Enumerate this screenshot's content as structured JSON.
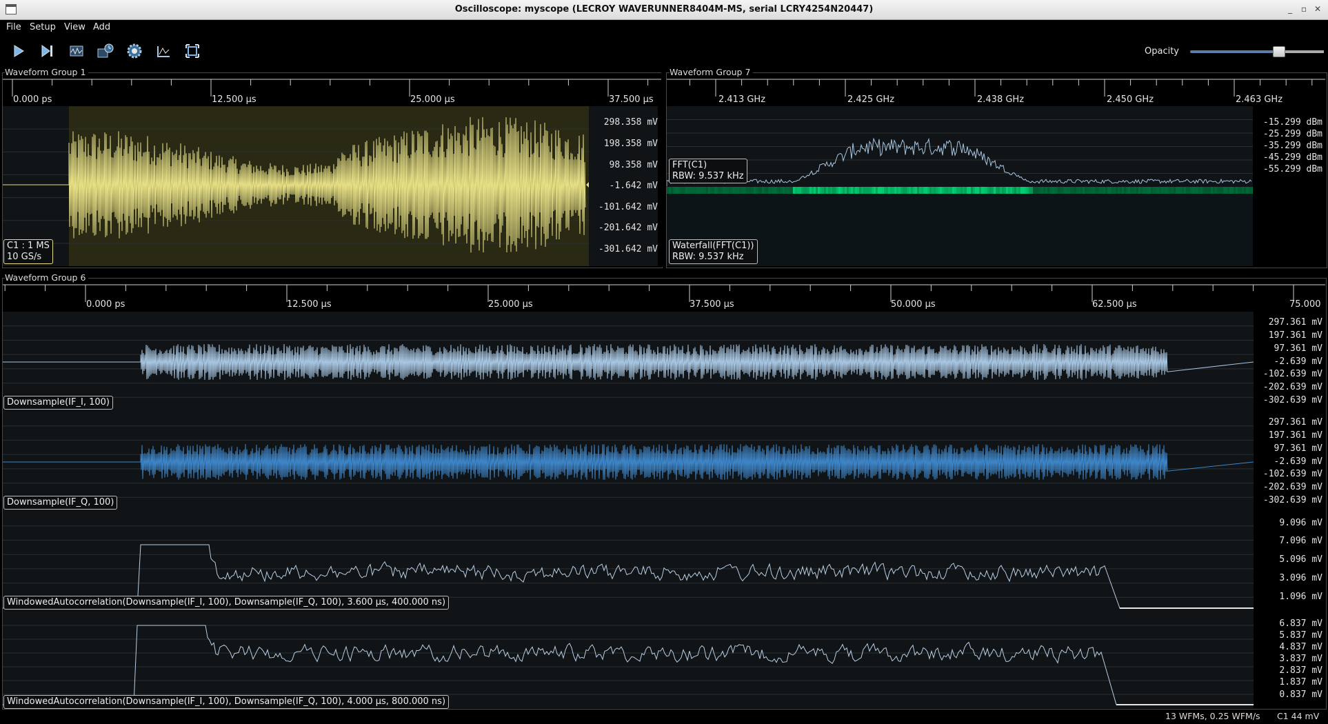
{
  "window": {
    "title": "Oscilloscope: myscope (LECROY WAVERUNNER8404M-MS, serial LCRY4254N20447)",
    "buttons": [
      "_",
      "▫",
      "✕"
    ]
  },
  "menu": [
    "File",
    "Setup",
    "View",
    "Add"
  ],
  "toolbar": {
    "buttons": [
      "start-icon",
      "single-trigger-icon",
      "waveform-icon",
      "history-icon",
      "settings-icon",
      "autoscale-icon",
      "fullscreen-icon"
    ],
    "opacity_label": "Opacity",
    "opacity_value": 0.66
  },
  "groups": {
    "g1": {
      "title": "Waveform Group 1",
      "ticks": [
        "0.000 ps",
        "12.500 µs",
        "25.000 µs",
        "37.500 µs"
      ],
      "yaxis": [
        "298.358 mV",
        "198.358 mV",
        "98.358 mV",
        "-1.642 mV",
        "-101.642 mV",
        "-201.642 mV",
        "-301.642 mV"
      ],
      "label_line1": "C1 : 1 MS",
      "label_line2": "10 GS/s",
      "trace_color": "#e6df86"
    },
    "g7": {
      "title": "Waveform Group 7",
      "ticks": [
        "2.413 GHz",
        "2.425 GHz",
        "2.438 GHz",
        "2.450 GHz",
        "2.463 GHz"
      ],
      "yaxis": [
        "-15.299 dBm",
        "-25.299 dBm",
        "-35.299 dBm",
        "-45.299 dBm",
        "-55.299 dBm"
      ],
      "fft_label1": "FFT(C1)",
      "fft_label2": "RBW: 9.537 kHz",
      "wf_label1": "Waterfall(FFT(C1))",
      "wf_label2": "RBW: 9.537 kHz"
    },
    "g6": {
      "title": "Waveform Group 6",
      "ticks": [
        "0.000 ps",
        "12.500 µs",
        "25.000 µs",
        "37.500 µs",
        "50.000 µs",
        "62.500 µs",
        "75.000"
      ],
      "panels": [
        {
          "label": "Downsample(IF_I, 100)",
          "yaxis": [
            "297.361 mV",
            "197.361 mV",
            "97.361 mV",
            "-2.639 mV",
            "-102.639 mV",
            "-202.639 mV",
            "-302.639 mV"
          ],
          "color": "#a9c7e2"
        },
        {
          "label": "Downsample(IF_Q, 100)",
          "yaxis": [
            "297.361 mV",
            "197.361 mV",
            "97.361 mV",
            "-2.639 mV",
            "-102.639 mV",
            "-202.639 mV",
            "-302.639 mV"
          ],
          "color": "#3f86c8"
        },
        {
          "label": "WindowedAutocorrelation(Downsample(IF_I, 100), Downsample(IF_Q, 100), 3.600 µs, 400.000 ns)",
          "yaxis": [
            "9.096 mV",
            "7.096 mV",
            "5.096 mV",
            "3.096 mV",
            "1.096 mV"
          ],
          "color": "#b9cfe4"
        },
        {
          "label": "WindowedAutocorrelation(Downsample(IF_I, 100), Downsample(IF_Q, 100), 4.000 µs, 800.000 ns)",
          "yaxis": [
            "6.837 mV",
            "5.837 mV",
            "4.837 mV",
            "3.837 mV",
            "2.837 mV",
            "1.837 mV",
            "0.837 mV"
          ],
          "color": "#b9cfe4"
        }
      ]
    }
  },
  "status": {
    "wfms": "13 WFMs, 0.25 WFM/s",
    "trigger": "C1 44 mV"
  }
}
